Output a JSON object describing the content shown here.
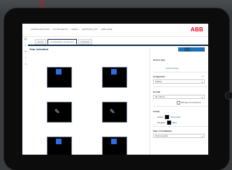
{
  "nav": {
    "links": [
      "CONFIGURATIONS",
      "MY PROJECTS",
      "MEDIA",
      "SHOPPING LIST",
      "ABB HOME"
    ],
    "brand": "ABB"
  },
  "tabs": [
    {
      "label": "Home"
    },
    {
      "label": "Configuration of Function"
    },
    {
      "label": "Overview"
    }
  ],
  "main": {
    "title": "Your selection",
    "grid": [
      {
        "type": "blue-square"
      },
      {
        "type": "blue-square"
      },
      {
        "type": "pencil"
      },
      {
        "type": "pencil"
      },
      {
        "type": "blue-square"
      },
      {
        "type": "blue-square"
      }
    ]
  },
  "panel": {
    "sensor_type_label": "Sensor type",
    "sensor_link": "Current element",
    "assignment_label": "Assignment",
    "assignment_value": "Nothing",
    "format_label": "Format",
    "format_value": "38 x 38 mm",
    "checkbox_label": "with logo on the element",
    "colour_label": "Colour",
    "colour_surface_label": "Surface",
    "colour_surface_value": "Glossy black",
    "colour_pictogram_label": "Pictogram",
    "colour_pictogram_value": "Black",
    "type_installation_label": "Type of installation",
    "type_installation_value": "Flush-mounted"
  },
  "colors": {
    "accent": "#0b2a4a",
    "button": "#1f6fb4",
    "brand_red": "#e2001a",
    "tile_blue": "#2e6de0"
  }
}
